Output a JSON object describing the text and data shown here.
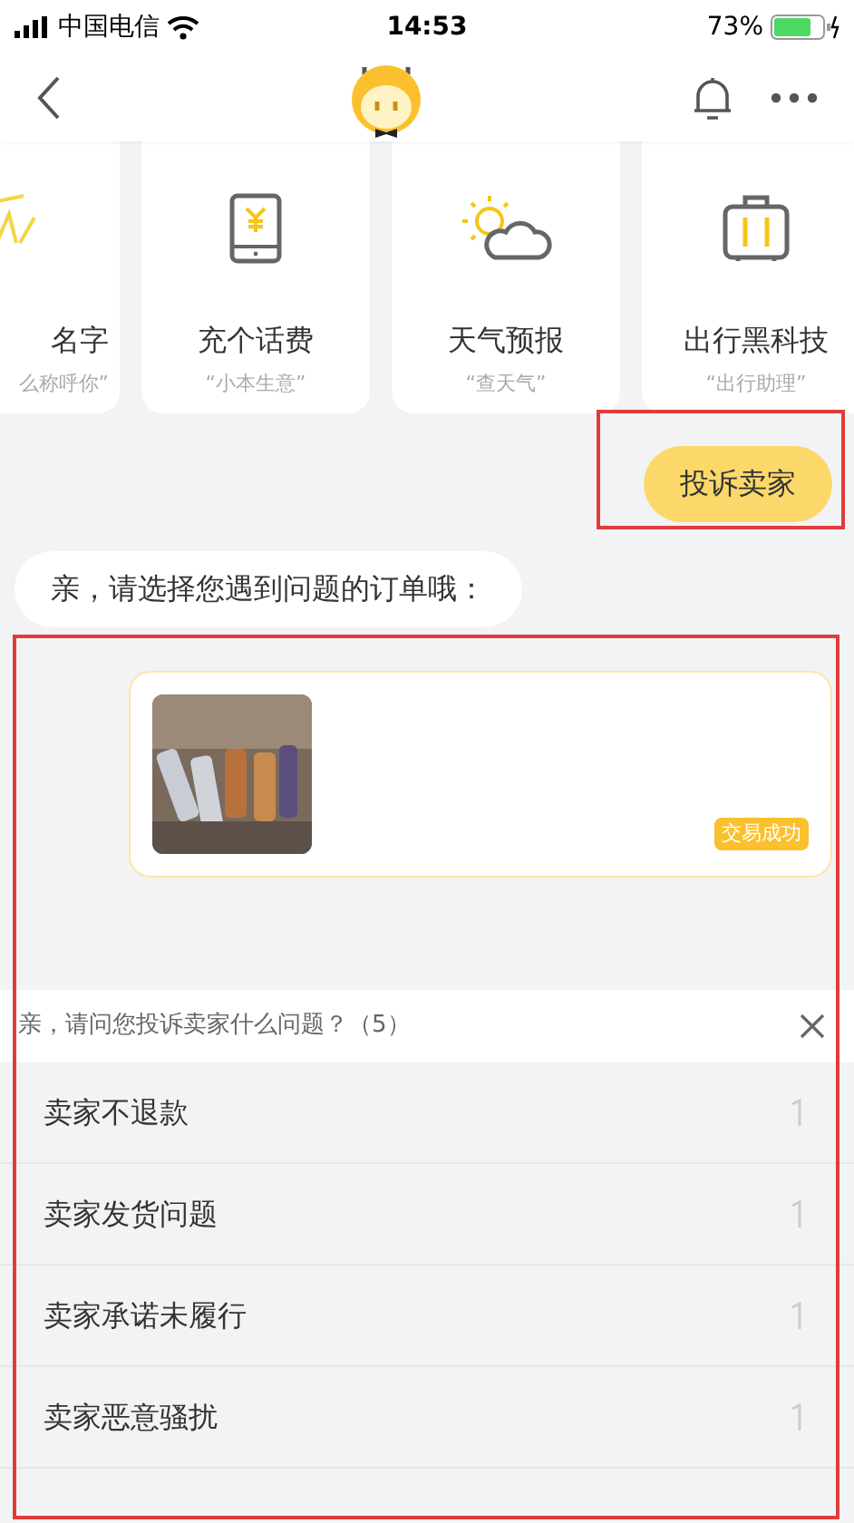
{
  "status_bar": {
    "carrier": "中国电信",
    "time": "14:53",
    "battery": "73%"
  },
  "services": [
    {
      "kind": "name",
      "title": "名字",
      "subtitle": "么称呼你”"
    },
    {
      "kind": "phone",
      "title": "充个话费",
      "subtitle": "“小本生意”"
    },
    {
      "kind": "weather",
      "title": "天气预报",
      "subtitle": "“查天气”"
    },
    {
      "kind": "luggage",
      "title": "出行黑科技",
      "subtitle": "“出行助理”"
    }
  ],
  "user_message": "投诉卖家",
  "bot_message": "亲，请选择您遇到问题的订单哦：",
  "order": {
    "status": "交易成功"
  },
  "sheet": {
    "title": "亲，请问您投诉卖家什么问题？（5）",
    "options": [
      "卖家不退款",
      "卖家发货问题",
      "卖家承诺未履行",
      "卖家恶意骚扰"
    ]
  }
}
